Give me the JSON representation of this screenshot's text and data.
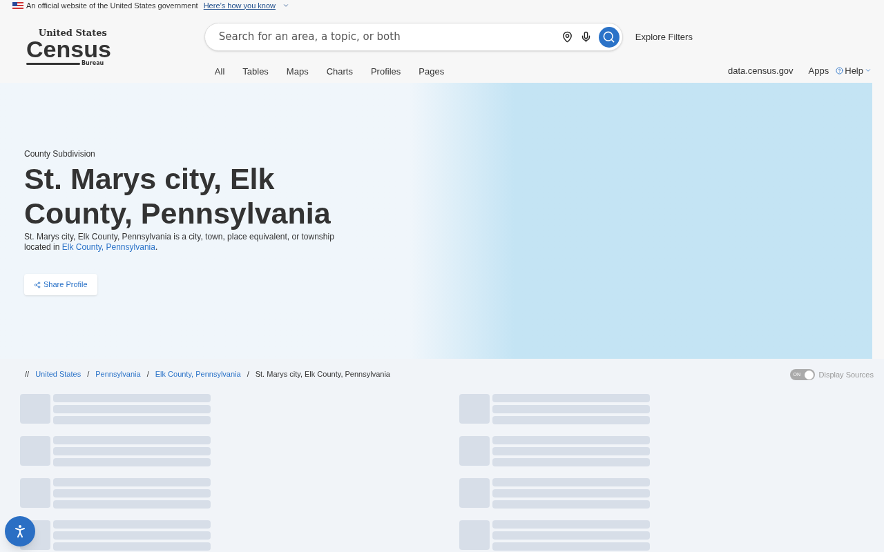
{
  "gov_banner": {
    "text": "An official website of the United States government",
    "link": "Here’s how you know"
  },
  "logo": {
    "line_1": "United States",
    "line_2": "Census",
    "line_3": "Bureau"
  },
  "search": {
    "placeholder": "Search for an area, a topic, or both"
  },
  "explore_filters": "Explore Filters",
  "tabs": [
    {
      "label": "All"
    },
    {
      "label": "Tables"
    },
    {
      "label": "Maps"
    },
    {
      "label": "Charts"
    },
    {
      "label": "Profiles"
    },
    {
      "label": "Pages"
    }
  ],
  "utility_links": [
    {
      "label": "data.census.gov",
      "kind": "link"
    },
    {
      "label": "Apps",
      "kind": "link"
    },
    {
      "label": "Help",
      "kind": "menu"
    }
  ],
  "hero": {
    "eyebrow": "County Subdivision",
    "title": "St. Marys city, Elk County, Pennsylvania",
    "description": "St. Marys city, Elk County, Pennsylvania is a city, town, place equivalent, or township located in",
    "description_link": "Elk County, Pennsylvania",
    "description_end": ".",
    "share_button": "Share Profile"
  },
  "breadcrumb": {
    "prefix": "//",
    "items": [
      {
        "label": "United States",
        "kind": "link"
      },
      {
        "label": "Pennsylvania",
        "kind": "link"
      },
      {
        "label": "Elk County, Pennsylvania",
        "kind": "link"
      },
      {
        "label": "St. Marys city, Elk County, Pennsylvania",
        "kind": "current"
      }
    ],
    "separator": "/"
  },
  "display_sources": {
    "label": "Display Sources",
    "toggle_text": "ON",
    "on": true
  }
}
